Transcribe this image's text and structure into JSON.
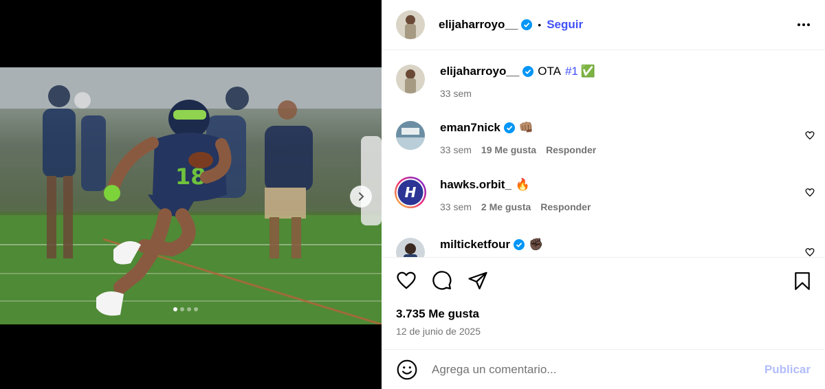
{
  "post": {
    "author": "elijaharroyo__",
    "follow_label": "Seguir",
    "separator": "•",
    "likes": "3.735 Me gusta",
    "date": "12 de junio de 2025",
    "carousel": {
      "slides": 4,
      "active_slide": 1
    }
  },
  "caption": {
    "user": "elijaharroyo__",
    "text": "OTA",
    "hashtag": "#1",
    "emoji": "✅",
    "time": "33 sem"
  },
  "comments": [
    {
      "user": "eman7nick",
      "verified": true,
      "emoji": "👊🏽",
      "time": "33 sem",
      "likes": "19 Me gusta",
      "reply": "Responder"
    },
    {
      "user": "hawks.orbit_",
      "verified": false,
      "emoji": "🔥",
      "time": "33 sem",
      "likes": "2 Me gusta",
      "reply": "Responder"
    },
    {
      "user": "milticketfour",
      "verified": true,
      "emoji": "✊🏿",
      "time": "",
      "likes": "",
      "reply": ""
    }
  ],
  "composer": {
    "placeholder": "Agrega un comentario...",
    "publish_label": "Publicar"
  },
  "colors": {
    "accent": "#4150f7",
    "verified": "#0095f6",
    "publish_disabled": "#b2bdfb",
    "secondary_text": "#737373"
  },
  "icons": [
    "verified-icon",
    "more-options-icon",
    "like-icon",
    "comment-icon",
    "share-icon",
    "save-icon",
    "emoji-icon",
    "next-arrow-icon"
  ]
}
